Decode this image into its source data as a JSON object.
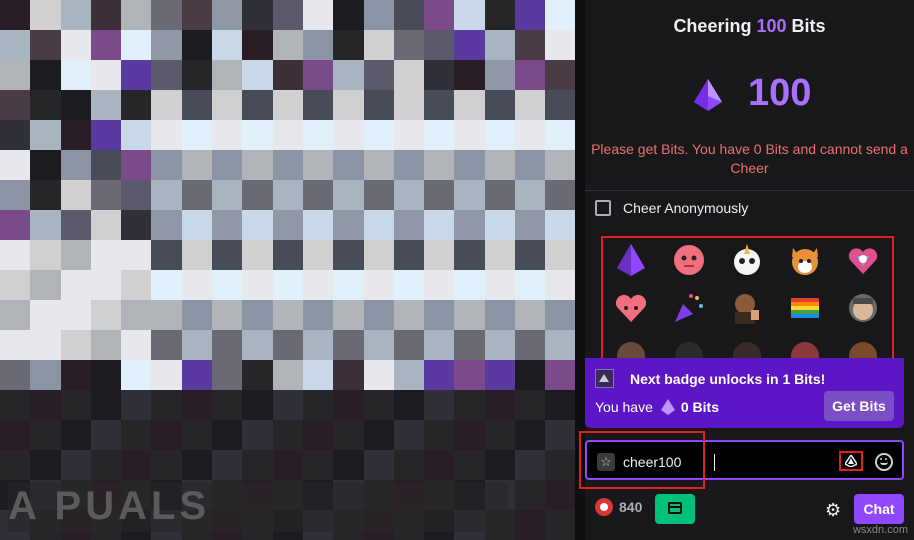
{
  "header": {
    "prefix": "Cheering",
    "amount": "100",
    "suffix": "Bits"
  },
  "big_amount": "100",
  "warning": "Please get Bits. You have 0 Bits and cannot send a Cheer",
  "anonymous_label": "Cheer Anonymously",
  "emotes": [
    [
      "bits-gem",
      "blob-face",
      "panda-unicorn",
      "corgi",
      "unicorn-heart"
    ],
    [
      "heart-face",
      "party-horn",
      "streamer-thumbs-up",
      "rainbow-flag",
      "streamer-face"
    ]
  ],
  "badge": {
    "message": "Next badge unlocks in 1 Bits!",
    "have_label": "You have",
    "have_value": "0 Bits",
    "get_bits": "Get Bits"
  },
  "input": {
    "value": "cheer100"
  },
  "footer": {
    "points": "840",
    "chat_button": "Chat"
  },
  "brand": "wsxdn.com",
  "watermark": "A PUALS",
  "colors": {
    "accent": "#a970ff",
    "brand_purple": "#9147ff",
    "warning": "#eb7070",
    "annotation_red": "#e02020"
  }
}
